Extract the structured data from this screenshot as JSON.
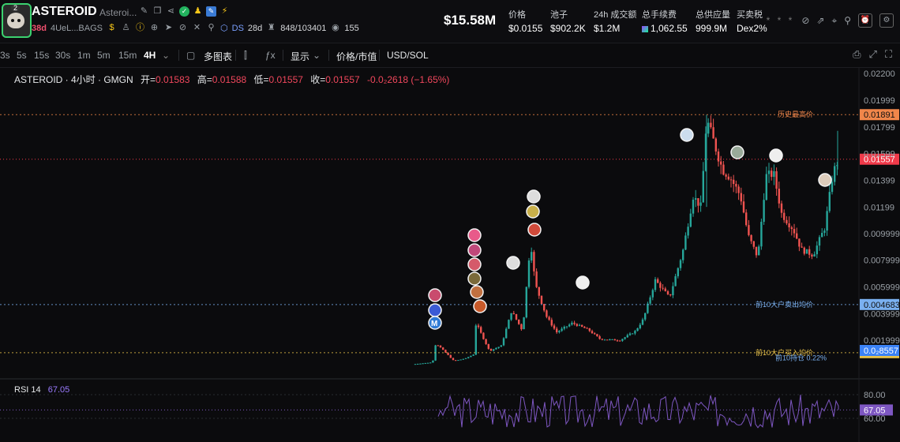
{
  "token": {
    "symbol": "ASTEROID",
    "name_short": "Asteroi...",
    "age": "38d",
    "address_short": "4UeL...BAGS",
    "ds_age": "28d",
    "holders_ratio": "848/103401",
    "views": "155",
    "avatar_badge": "2"
  },
  "stats": {
    "market_cap": "$15.58M",
    "price_label": "价格",
    "price_value": "$0.0155",
    "pool_label": "池子",
    "pool_value": "$902.2K",
    "volume_label": "24h 成交额",
    "volume_value": "$1.2M",
    "fees_label": "总手续费",
    "fees_value": "1,062.55",
    "supply_label": "总供应量",
    "supply_value": "999.9M",
    "tax_label": "买卖税",
    "tax_value": "Dex2%"
  },
  "header_dots": "* * *",
  "toolbar": {
    "timeframes": [
      "3s",
      "5s",
      "15s",
      "30s",
      "1m",
      "5m",
      "15m",
      "4H"
    ],
    "active_timeframe": "4H",
    "multi_chart": "多图表",
    "display": "显示",
    "price_mcap": "价格/市值",
    "currency": "USD/SOL"
  },
  "legend": {
    "title": "ASTEROID · 4小时 · GMGN",
    "open_label": "开=",
    "open": "0.01583",
    "high_label": "高=",
    "high": "0.01588",
    "low_label": "低=",
    "low": "0.01557",
    "close_label": "收=",
    "close": "0.01557",
    "change": "-0.0₂2618 (−1.65%)"
  },
  "rsi": {
    "label": "RSI",
    "period": "14",
    "value": "67.05",
    "value_tag": "67.05"
  },
  "colors": {
    "up": "#26a69a",
    "down": "#ef5350",
    "bg": "#0b0b0d",
    "ath": "#f0864a",
    "sell_avg": "#7ab0f0",
    "buy_avg": "#e8c24a",
    "last_price": "#f03a4a",
    "rsi": "#7e57c2"
  },
  "chart_data": {
    "type": "candlestick",
    "y_axis_scale": "linear",
    "ylim": [
      0,
      0.022
    ],
    "yticks": [
      0.022,
      0.01999,
      0.01799,
      0.01599,
      0.01399,
      0.01199,
      0.009999,
      0.007999,
      0.005999,
      0.003999,
      0.001999
    ],
    "ytick_labels": [
      "0.02200",
      "0.01999",
      "0.01799",
      "0.01599",
      "0.01399",
      "0.01199",
      "0.009999",
      "0.007999",
      "0.005999",
      "0.003999",
      "0.001999"
    ],
    "last_price": 0.01557,
    "last_price_label": "0.01557",
    "lines": [
      {
        "label": "历史最高价",
        "value": 0.01891,
        "tag": "0.01891"
      },
      {
        "label": "前10大户卖出均价",
        "value": 0.004683,
        "tag": "0.004683"
      },
      {
        "label": "前10大户买入均价",
        "value": 0.001075,
        "tag": "0.001075"
      }
    ],
    "low_marker": {
      "label": "前10持仓 0.22%",
      "tag": "0.0₂8557"
    },
    "rsi_ticks": [
      80,
      60
    ],
    "rsi_tick_labels": [
      "80.00",
      "60.00"
    ],
    "rsi_ylim": [
      40,
      90
    ]
  }
}
